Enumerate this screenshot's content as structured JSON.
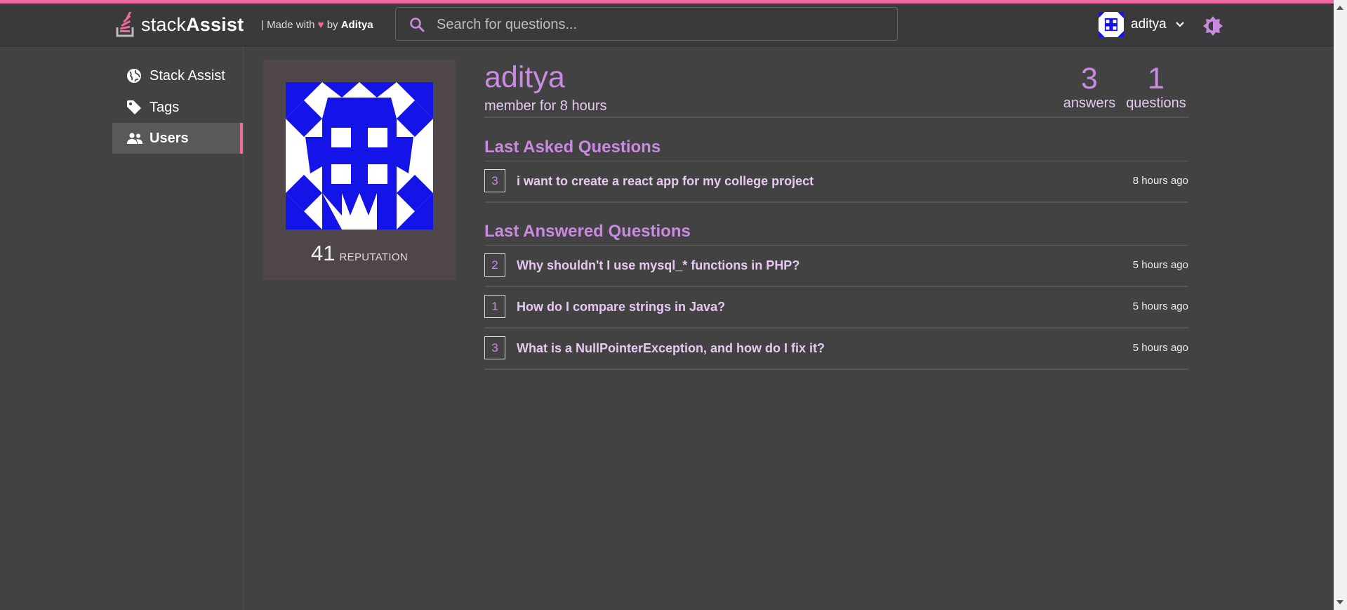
{
  "app": {
    "logo_prefix": "stack",
    "logo_suffix": "Assist",
    "made_with_prefix": "| Made with",
    "made_with_by": "by",
    "author": "Aditya",
    "accent": "#ed6a9f",
    "purple": "#c88be0",
    "identicon_color": "#1414e8"
  },
  "search": {
    "placeholder": "Search for questions..."
  },
  "user_menu": {
    "name": "aditya"
  },
  "sidebar": {
    "items": [
      {
        "label": "Stack Assist",
        "icon": "globe-icon",
        "active": false
      },
      {
        "label": "Tags",
        "icon": "tag-icon",
        "active": false
      },
      {
        "label": "Users",
        "icon": "users-icon",
        "active": true
      }
    ]
  },
  "profile": {
    "name": "aditya",
    "member_since": "member for 8 hours",
    "reputation": "41",
    "reputation_label": "REPUTATION",
    "answers": "3",
    "answers_label": "answers",
    "questions": "1",
    "questions_label": "questions"
  },
  "asked": {
    "title": "Last Asked Questions",
    "items": [
      {
        "count": "3",
        "title": "i want to create a react app for my college project",
        "time": "8 hours ago"
      }
    ]
  },
  "answered": {
    "title": "Last Answered Questions",
    "items": [
      {
        "count": "2",
        "title": "Why shouldn't I use mysql_* functions in PHP?",
        "time": "5 hours ago"
      },
      {
        "count": "1",
        "title": "How do I compare strings in Java?",
        "time": "5 hours ago"
      },
      {
        "count": "3",
        "title": "What is a NullPointerException, and how do I fix it?",
        "time": "5 hours ago"
      }
    ]
  }
}
